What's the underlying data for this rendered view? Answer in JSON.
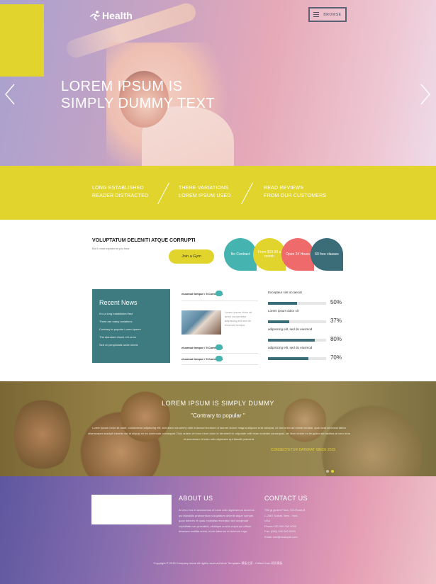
{
  "brand": {
    "logo_text": "Health"
  },
  "nav": {
    "browse_label": "BROWSE"
  },
  "hero": {
    "title_line1": "LOREM IPSUM IS",
    "title_line2": "SIMPLY DUMMY TEXT"
  },
  "band": {
    "items": [
      {
        "line1": "LONG ESTABLISHED",
        "line2": "READER DISTRACTED"
      },
      {
        "line1": "THERE VARIATIONS",
        "line2": "LOREM IPSUM USED"
      },
      {
        "line1": "READ REVIEWS",
        "line2": "FROM OUR CUSTOMERS"
      }
    ]
  },
  "intro": {
    "title": "VOLUPTATUM DELENITI ATQUE CORRUPTI",
    "subtitle": "But I must explain to you how",
    "button_label": "Join a Gym",
    "bubbles": [
      {
        "text": "No Contract",
        "color": "#45b3b0"
      },
      {
        "text": "From $19.99 a month",
        "color": "#e1d42c"
      },
      {
        "text": "Open 24 Hours",
        "color": "#ef6b6b"
      },
      {
        "text": "60 free classes",
        "color": "#3b6d78"
      }
    ]
  },
  "recent_news": {
    "title": "Recent News",
    "items": [
      "It is a long established fact",
      "There are many variations",
      "Contrary to popular Lorem Ipsum",
      "The standard chunk of Lorem",
      "Sed ut perspiciatis unde omnis"
    ]
  },
  "news_meta": [
    "eiusmod tempor / 5 Comments",
    "eiusmod tempor / 5 Comments",
    "eiusmod tempor / 5 Comments"
  ],
  "news_snippet": "Lorem ipsum dolor sit amet consectetur adipiscing elit sed do eiusmod tempor",
  "stats": [
    {
      "label": "Excepteur sint occaecat",
      "value": "50%",
      "fraction": 0.5
    },
    {
      "label": "Lorem ipsum dolor sit",
      "value": "37%",
      "fraction": 0.37
    },
    {
      "label": "adipisicing elit, sed do eiusmod",
      "value": "80%",
      "fraction": 0.8
    },
    {
      "label": "adipisicing elit, sed do eiusmod",
      "value": "70%",
      "fraction": 0.7
    }
  ],
  "testimonial": {
    "title": "LOREM IPSUM IS SIMPLY DUMMY",
    "quote": "\"Contrary to popular \"",
    "body": "Lorem ipsum dolor sit amet, consectetur adipiscing elit, sed diam nonummy nibh euismod tincidunt ut laoreet dolore magna aliquam erat volutpat. Ut wisi enim ad minim veniam, quis nostrud exerci tation ullamcorper suscipit lobortis nisl ut aliquip ex ea commodo consequat. Duis autem vel eum iriure dolor in hendrerit in vulputate velit esse molestie consequat, vel illum dolore eu feugiat nulla facilisis at vero eros et accumsan et iusto odio dignissim qui blandit praesent.",
    "sign": "CONSECTETUR DATERAT SINCE 2015"
  },
  "footer": {
    "about_title": "ABOUT US",
    "about_text": "At vero eos et accusamus et iusto odio dignissimos ducimus qui blanditiis praesentium voluptatum deleniti atque corrupti quos dolores et quas molestias excepturi sint occaecati cupiditate non provident, similique sunt in culpa qui officia deserunt mollitia animi, id est laborum et dolorum fuga.",
    "contact_title": "CONTACT US",
    "contact_lines": [
      "756 gt globel Place, CD-Road,M",
      "L-2867 Kotkat. New - York.",
      "USA",
      "Phone:+00 000 000 0000",
      "Fax: (000) 000 000 0000",
      "Email: info@example.com"
    ],
    "copyright": "Copyright © 2015.Company name All rights reserved.More Templates 模板之家 - Collect from 网页模板"
  }
}
